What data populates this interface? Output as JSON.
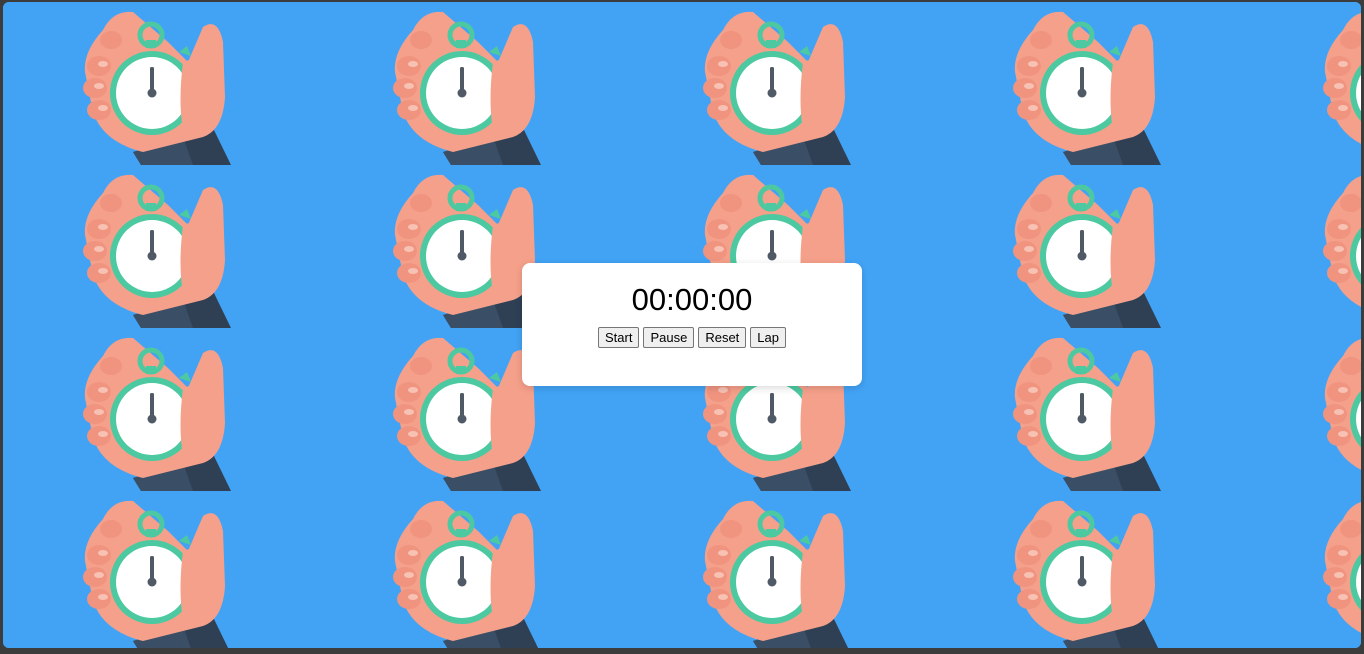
{
  "timer": {
    "display": "00:00:00"
  },
  "controls": {
    "start_label": "Start",
    "pause_label": "Pause",
    "reset_label": "Reset",
    "lap_label": "Lap"
  },
  "background": {
    "image": "hand-holding-stopwatch-illustration",
    "color": "#42a3f5",
    "tile_columns": 5,
    "tile_rows": 4
  }
}
